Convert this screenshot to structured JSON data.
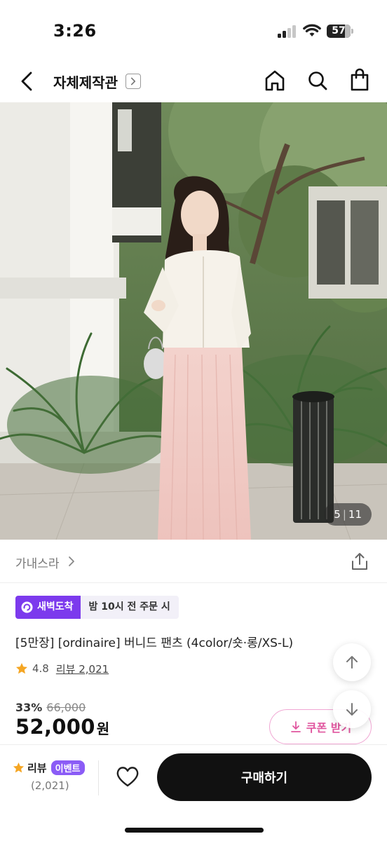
{
  "status_bar": {
    "time": "3:26",
    "battery": "57"
  },
  "nav": {
    "title": "자체제작관"
  },
  "photo": {
    "current": "5",
    "separator": "|",
    "total": "11"
  },
  "brand": {
    "name": "가내스라"
  },
  "delivery": {
    "badge_label": "새벽도착",
    "cutoff_text": "밤 10시 전 주문 시"
  },
  "product": {
    "title": "[5만장] [ordinaire] 버니드 팬츠 (4color/숏·롱/XS-L)",
    "rating": "4.8",
    "review_link": "리뷰 2,021",
    "discount_rate": "33%",
    "original_price": "66,000",
    "price": "52,000",
    "currency": "원"
  },
  "coupon": {
    "label": "쿠폰 받기"
  },
  "bottom_bar": {
    "review_label": "리뷰",
    "event_badge": "이벤트",
    "review_count": "(2,021)",
    "buy_label": "구매하기"
  },
  "colors": {
    "delivery_purple": "#7c3aed",
    "coupon_pink": "#e0569f",
    "star_orange": "#f5a623",
    "buy_button": "#111111"
  },
  "icons": [
    "back-icon",
    "chevron-right-icon",
    "home-icon",
    "search-icon",
    "shopping-bag-icon",
    "share-icon",
    "dawn-delivery-icon",
    "star-icon",
    "arrow-up-icon",
    "arrow-down-icon",
    "download-icon",
    "heart-icon"
  ]
}
